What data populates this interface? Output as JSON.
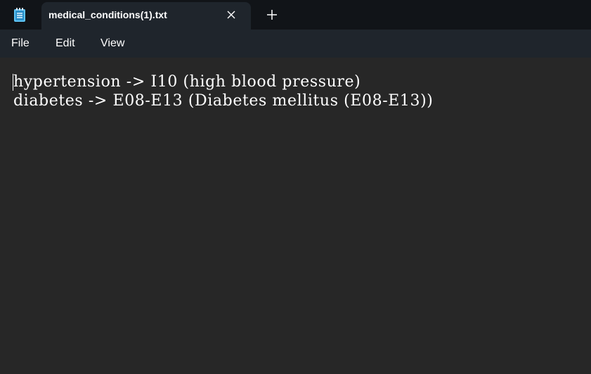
{
  "app": {
    "icon": "notepad-icon",
    "accent_color": "#4cc2ff"
  },
  "tab": {
    "title": "medical_conditions(1).txt",
    "close_icon": "close-icon"
  },
  "new_tab_icon": "plus-icon",
  "menu": {
    "file": "File",
    "edit": "Edit",
    "view": "View"
  },
  "editor": {
    "lines": [
      "hypertension -> I10 (high blood pressure)",
      "diabetes -> E08-E13 (Diabetes mellitus (E08-E13))"
    ]
  },
  "colors": {
    "titlebar_bg": "#111418",
    "tab_bg": "#1f252c",
    "editor_bg": "#272727",
    "text": "#ffffff"
  }
}
